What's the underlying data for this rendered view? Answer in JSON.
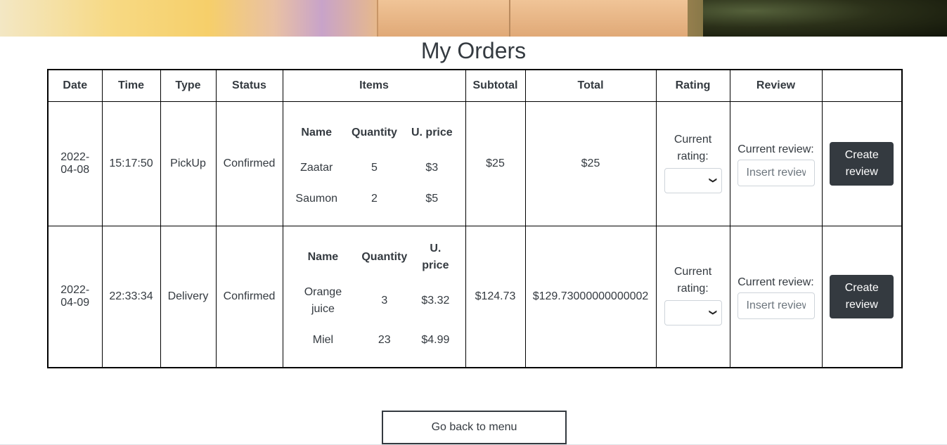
{
  "page": {
    "title": "My Orders"
  },
  "table": {
    "headers": [
      "Date",
      "Time",
      "Type",
      "Status",
      "Items",
      "Subtotal",
      "Total",
      "Rating",
      "Review",
      ""
    ],
    "item_headers": [
      "Name",
      "Quantity",
      "U. price"
    ],
    "rating_label": "Current rating:",
    "review_label": "Current review:",
    "review_placeholder": "Insert review",
    "create_button": "Create review",
    "orders": [
      {
        "date": "2022-04-08",
        "time": "15:17:50",
        "type": "PickUp",
        "status": "Confirmed",
        "items": [
          {
            "name": "Zaatar",
            "quantity": "5",
            "unit_price": "$3"
          },
          {
            "name": "Saumon",
            "quantity": "2",
            "unit_price": "$5"
          }
        ],
        "subtotal": "$25",
        "total": "$25",
        "rating": ""
      },
      {
        "date": "2022-04-09",
        "time": "22:33:34",
        "type": "Delivery",
        "status": "Confirmed",
        "items": [
          {
            "name": "Orange juice",
            "quantity": "3",
            "unit_price": "$3.32"
          },
          {
            "name": "Miel",
            "quantity": "23",
            "unit_price": "$4.99"
          }
        ],
        "subtotal": "$124.73",
        "total": "$129.73000000000002",
        "rating": ""
      }
    ]
  },
  "footer": {
    "back_button": "Go back to menu"
  },
  "colors": {
    "text": "#343a40",
    "button_bg": "#343a40",
    "button_text": "#ffffff",
    "border": "#000000"
  }
}
